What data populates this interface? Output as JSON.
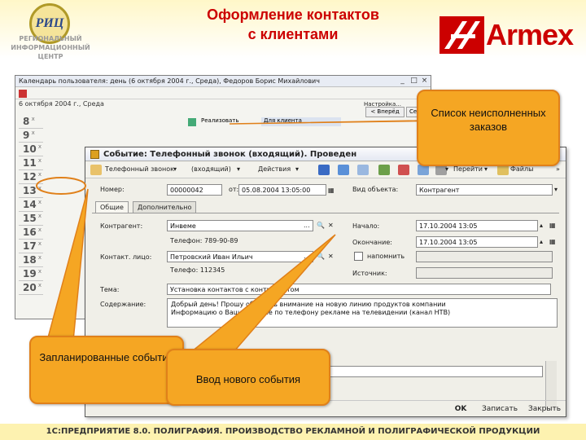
{
  "slide": {
    "title_line1": "Оформление контактов",
    "title_line2": "с клиентами",
    "logo_left_mark": "РИЦ",
    "logo_left_text": "РЕГИОНАЛЬНЫЙ ИНФОРМАЦИОННЫЙ ЦЕНТР",
    "logo_right_text": "Armex",
    "footer": "1С:ПРЕДПРИЯТИЕ 8.0. ПОЛИГРАФИЯ. ПРОИЗВОДСТВО РЕКЛАМНОЙ И ПОЛИГРАФИЧЕСКОЙ ПРОДУКЦИИ",
    "brand_color": "#cc0000",
    "callout_color": "#f5a623"
  },
  "callouts": {
    "orders": "Список неисполненных заказов",
    "planned": "Запланированные события",
    "new_event": "Ввод нового события"
  },
  "calendar_window": {
    "title": "Календарь пользователя: день (6 октября 2004 г., Среда), Федоров Борис Михайлович",
    "date_label": "6 октября 2004 г., Среда",
    "btn_setup": "Настройка...",
    "btn_back": "< Вперёд",
    "btn_today": "Сегод",
    "hours": [
      "8",
      "9",
      "10",
      "11",
      "12",
      "13",
      "14",
      "15",
      "16",
      "17",
      "18",
      "19",
      "20"
    ],
    "event_text": "Реализовать",
    "event_text2": "Для клиента"
  },
  "event_window": {
    "title": "Событие: Телефонный звонок (входящий). Проведен",
    "toolbar": {
      "type": "Телефонный звонок",
      "direction": "(входящий)",
      "actions": "Действия",
      "goto": "Перейти",
      "files": "Файлы"
    },
    "number_label": "Номер:",
    "number_value": "00000042",
    "from_label": "от:",
    "from_value": "05.08.2004 13:05:00",
    "object_type_label": "Вид объекта:",
    "object_type_value": "Контрагент",
    "tabs": [
      "Общие",
      "Дополнительно"
    ],
    "counterparty_label": "Контрагент:",
    "counterparty_value": "Инвеме",
    "phone1": "Телефон: 789-90-89",
    "contact_label": "Контакт. лицо:",
    "contact_value": "Петровский Иван Ильич",
    "phone2": "Телефо: 112345",
    "start_label": "Начало:",
    "start_value": "17.10.2004 13:05",
    "end_label": "Окончание:",
    "end_value": "17.10.2004 13:05",
    "remind_label": "напомнить",
    "source_label": "Источник:",
    "subject_label": "Тема:",
    "subject_value": "Установка контактов с контрагентом",
    "content_label": "Содержание:",
    "content_line1": "Добрый день! Прошу обратить внимание на новую линию продуктов компании",
    "content_line2": "Информацию о Вашей фирме по телефону рекламе на телевидении (канал НТВ)",
    "btn_ok": "OK",
    "btn_save": "Записать",
    "btn_close": "Закрыть"
  }
}
